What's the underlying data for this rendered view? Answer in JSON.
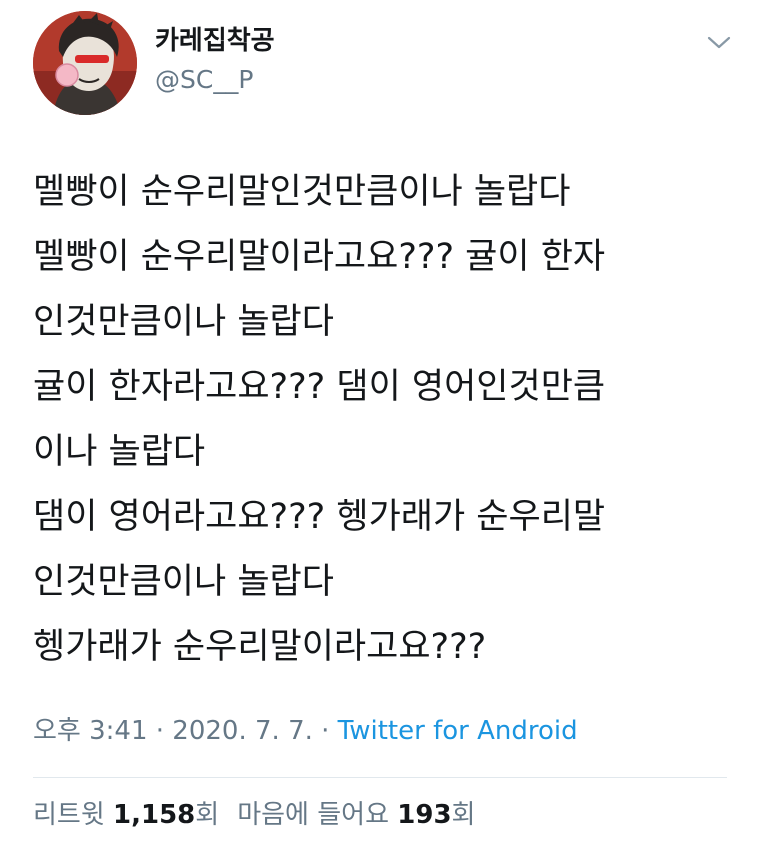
{
  "author": {
    "display_name": "카레집착공",
    "handle": "@SC__P",
    "avatar_icon": "illustrated-character-avatar"
  },
  "header": {
    "menu_icon": "chevron-down-icon"
  },
  "tweet": {
    "lines": [
      "멜빵이 순우리말인것만큼이나 놀랍다",
      "멜빵이 순우리말이라고요??? 귤이 한자",
      "인것만큼이나 놀랍다",
      "귤이 한자라고요??? 댐이 영어인것만큼",
      "이나 놀랍다",
      "댐이 영어라고요??? 헹가래가 순우리말",
      "인것만큼이나 놀랍다",
      "헹가래가 순우리말이라고요???"
    ],
    "time": "오후 3:41",
    "date": "2020. 7. 7.",
    "separator": "·",
    "source": "Twitter for Android"
  },
  "stats": {
    "retweets_label": "리트윗",
    "retweets_count": "1,158",
    "retweets_unit": "회",
    "likes_label": "마음에 들어요",
    "likes_count": "193",
    "likes_unit": "회"
  },
  "colors": {
    "text": "#14171a",
    "secondary": "#657786",
    "link": "#1b95e0",
    "divider": "#e1e8ed"
  }
}
